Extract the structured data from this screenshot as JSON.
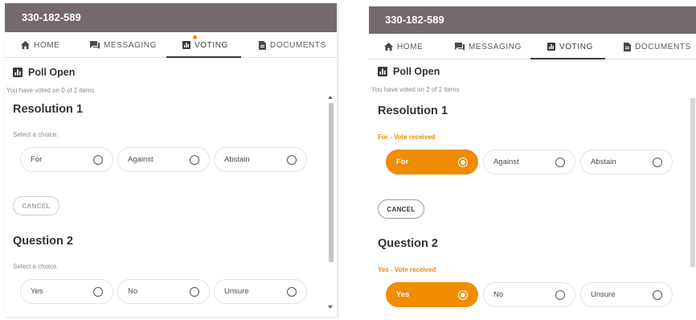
{
  "left": {
    "title": "330-182-589",
    "tabs": [
      {
        "label": "HOME",
        "icon": "home-icon"
      },
      {
        "label": "MESSAGING",
        "icon": "chat-icon"
      },
      {
        "label": "VOTING",
        "icon": "poll-icon",
        "active": true,
        "notification": true
      },
      {
        "label": "DOCUMENTS",
        "icon": "document-icon"
      }
    ],
    "poll_status": "Poll Open",
    "voted_text": "You have voted on 0 of 2 items",
    "sections": [
      {
        "title": "Resolution 1",
        "helper": "Select a choice.",
        "choices": [
          "For",
          "Against",
          "Abstain"
        ],
        "selected": null
      },
      {
        "title": "Question 2",
        "helper": "Select a choice.",
        "choices": [
          "Yes",
          "No",
          "Unsure"
        ],
        "selected": null
      }
    ],
    "cancel_label": "CANCEL"
  },
  "right": {
    "title": "330-182-589",
    "tabs": [
      {
        "label": "HOME",
        "icon": "home-icon"
      },
      {
        "label": "MESSAGING",
        "icon": "chat-icon"
      },
      {
        "label": "VOTING",
        "icon": "poll-icon",
        "active": true
      },
      {
        "label": "DOCUMENTS",
        "icon": "document-icon"
      }
    ],
    "poll_status": "Poll Open",
    "voted_text": "You have voted on 2 of 2 items",
    "sections": [
      {
        "title": "Resolution 1",
        "helper": "For - Vote received",
        "choices": [
          "For",
          "Against",
          "Abstain"
        ],
        "selected": "For"
      },
      {
        "title": "Question 2",
        "helper": "Yes - Vote received",
        "choices": [
          "Yes",
          "No",
          "Unsure"
        ],
        "selected": "Yes"
      }
    ],
    "cancel_label": "CANCEL"
  },
  "colors": {
    "header_bg": "#756a6b",
    "accent": "#ef8c00",
    "vote_received": "#e8890c"
  }
}
